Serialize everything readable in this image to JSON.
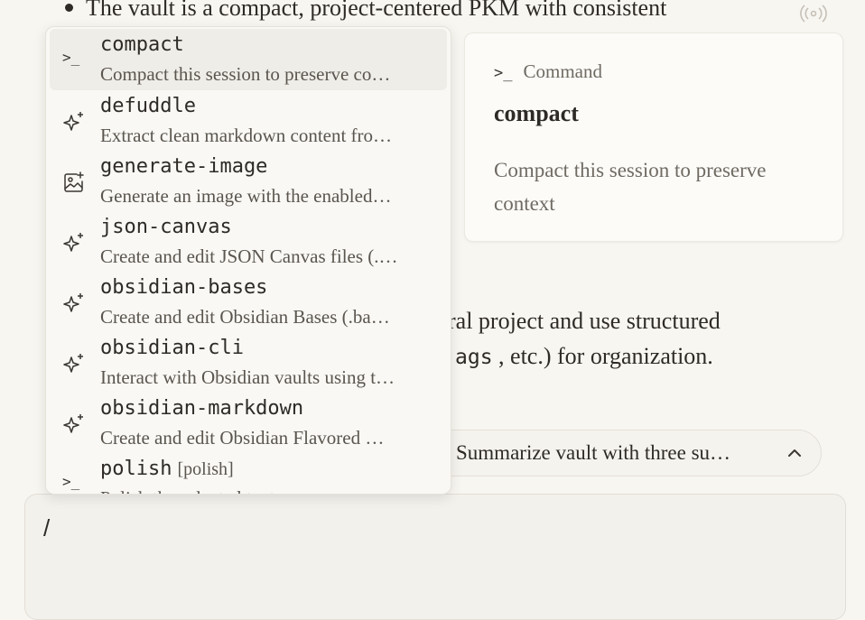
{
  "background": {
    "bullet_text": "The vault is a compact, project-centered PKM with consistent",
    "line2_text": "ral project and use structured",
    "line3_code": "ags",
    "line3_text": ", etc.) for organization."
  },
  "suggestion": {
    "label": "Summarize vault with three su…",
    "icon": "chevron-up-icon"
  },
  "input": {
    "value": "/"
  },
  "detail": {
    "kind_prompt": ">_",
    "kind_label": "Command",
    "name": "compact",
    "description": "Compact this session to preserve context"
  },
  "menu": {
    "items": [
      {
        "name": "compact",
        "alias": "",
        "description": "Compact this session to preserve co…",
        "icon": "terminal-prompt-icon",
        "selected": true
      },
      {
        "name": "defuddle",
        "alias": "",
        "description": "Extract clean markdown content fro…",
        "icon": "sparkles-icon"
      },
      {
        "name": "generate-image",
        "alias": "",
        "description": "Generate an image with the enabled…",
        "icon": "image-plus-icon"
      },
      {
        "name": "json-canvas",
        "alias": "",
        "description": "Create and edit JSON Canvas files (.…",
        "icon": "sparkles-icon"
      },
      {
        "name": "obsidian-bases",
        "alias": "",
        "description": "Create and edit Obsidian Bases (.ba…",
        "icon": "sparkles-icon"
      },
      {
        "name": "obsidian-cli",
        "alias": "",
        "description": "Interact with Obsidian vaults using t…",
        "icon": "sparkles-icon"
      },
      {
        "name": "obsidian-markdown",
        "alias": "",
        "description": "Create and edit Obsidian Flavored …",
        "icon": "sparkles-icon"
      },
      {
        "name": "polish",
        "alias": "[polish]",
        "description": "Polish the selected text",
        "icon": "terminal-prompt-icon"
      }
    ]
  }
}
